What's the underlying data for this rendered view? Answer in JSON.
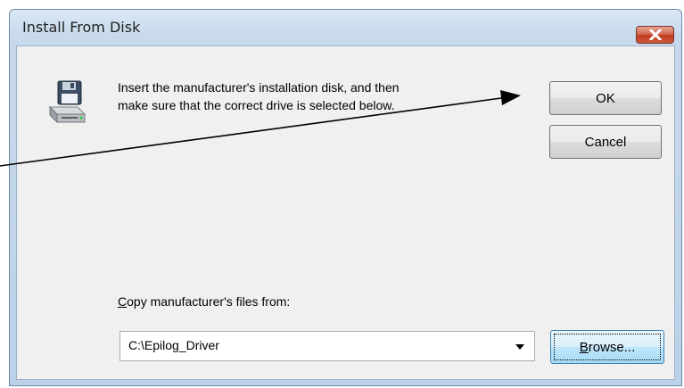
{
  "window": {
    "title": "Install From Disk",
    "close_icon": "close-x-icon"
  },
  "message": {
    "line1": "Insert the manufacturer's installation disk, and then",
    "line2": "make sure that the correct drive is selected below.",
    "icon": "floppy-disk-drive-icon"
  },
  "buttons": {
    "ok": "OK",
    "cancel": "Cancel",
    "browse_prefix": "B",
    "browse_rest": "rowse..."
  },
  "copy_from": {
    "label_prefix": "C",
    "label_rest": "opy manufacturer's files from:",
    "value": "C:\\Epilog_Driver",
    "arrow_icon": "dropdown-arrow-icon"
  },
  "annotation": {
    "type": "arrow",
    "points_to": "OK",
    "color": "#000000"
  },
  "colors": {
    "close_button": "#c7442b",
    "frame": "#c7d9ec",
    "dialog_background": "#f0f0f0"
  }
}
